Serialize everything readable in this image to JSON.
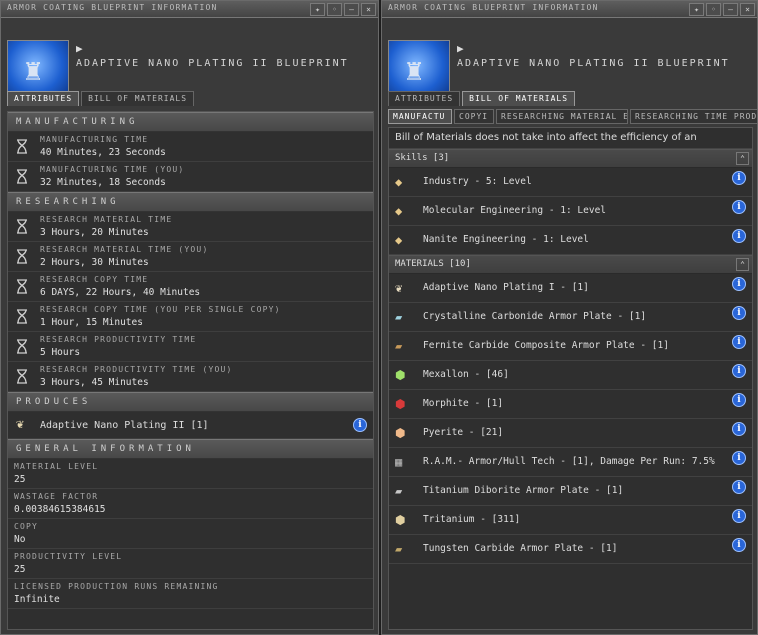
{
  "left_window": {
    "title": "ARMOR COATING BLUEPRINT INFORMATION",
    "blueprint_name": "ADAPTIVE NANO PLATING II BLUEPRINT",
    "tabs": [
      {
        "label": "ATTRIBUTES"
      },
      {
        "label": "BILL OF MATERIALS"
      }
    ],
    "sections": {
      "manufacturing": "MANUFACTURING",
      "researching": "RESEARCHING",
      "produces": "PRODUCES",
      "general": "GENERAL INFORMATION"
    },
    "manufacturing": [
      {
        "label": "MANUFACTURING TIME",
        "value": "40 Minutes, 23 Seconds"
      },
      {
        "label": "MANUFACTURING TIME (YOU)",
        "value": "32 Minutes, 18 Seconds"
      }
    ],
    "researching": [
      {
        "label": "RESEARCH MATERIAL TIME",
        "value": "3 Hours, 20 Minutes"
      },
      {
        "label": "RESEARCH MATERIAL TIME (YOU)",
        "value": "2 Hours, 30 Minutes"
      },
      {
        "label": "RESEARCH COPY TIME",
        "value": "6 DAYS, 22 Hours, 40 Minutes"
      },
      {
        "label": "RESEARCH COPY TIME (YOU PER SINGLE COPY)",
        "value": "1 Hour, 15 Minutes"
      },
      {
        "label": "RESEARCH PRODUCTIVITY TIME",
        "value": "5 Hours"
      },
      {
        "label": "RESEARCH PRODUCTIVITY TIME (YOU)",
        "value": "3 Hours, 45 Minutes"
      }
    ],
    "produces": {
      "text": "Adaptive Nano Plating II [1]"
    },
    "general": [
      {
        "label": "MATERIAL LEVEL",
        "value": "25"
      },
      {
        "label": "WASTAGE FACTOR",
        "value": "0.00384615384615"
      },
      {
        "label": "COPY",
        "value": "No"
      },
      {
        "label": "PRODUCTIVITY LEVEL",
        "value": "25"
      },
      {
        "label": "LICENSED PRODUCTION RUNS REMAINING",
        "value": "Infinite"
      }
    ]
  },
  "right_window": {
    "title": "ARMOR COATING BLUEPRINT INFORMATION",
    "blueprint_name": "ADAPTIVE NANO PLATING II BLUEPRINT",
    "tabs": [
      {
        "label": "ATTRIBUTES"
      },
      {
        "label": "BILL OF MATERIALS"
      }
    ],
    "subtabs": [
      {
        "label": "MANUFACTU"
      },
      {
        "label": "COPYI"
      },
      {
        "label": "RESEARCHING MATERIAL EI"
      },
      {
        "label": "RESEARCHING TIME PROD"
      }
    ],
    "notice": "Bill of Materials does not take into affect the efficiency of an Installation",
    "skills_header": "Skills [3]",
    "skills": [
      {
        "text": "Industry - 5: Level"
      },
      {
        "text": "Molecular Engineering - 1: Level"
      },
      {
        "text": "Nanite Engineering - 1: Level"
      }
    ],
    "materials_header": "MATERIALS [10]",
    "materials": [
      {
        "text": "Adaptive Nano Plating I - [1]",
        "icon": "armor-plating-icon",
        "color": "#e8dcc0"
      },
      {
        "text": "Crystalline Carbonide Armor Plate - [1]",
        "icon": "plate-icon",
        "color": "#9fd3e0"
      },
      {
        "text": "Fernite Carbide Composite Armor Plate - [1]",
        "icon": "plate-icon",
        "color": "#c89a5a"
      },
      {
        "text": "Mexallon - [46]",
        "icon": "mineral-icon",
        "color": "#9fe06a"
      },
      {
        "text": "Morphite - [1]",
        "icon": "mineral-icon",
        "color": "#d83a3a"
      },
      {
        "text": "Pyerite - [21]",
        "icon": "mineral-icon",
        "color": "#f0b98a"
      },
      {
        "text": "R.A.M.- Armor/Hull Tech - [1], Damage Per Run: 7.5%",
        "icon": "ram-tech-icon",
        "color": "#b0b0b0"
      },
      {
        "text": "Titanium Diborite Armor Plate - [1]",
        "icon": "plate-icon",
        "color": "#c8c8c8"
      },
      {
        "text": "Tritanium - [311]",
        "icon": "mineral-icon",
        "color": "#e0cfa0"
      },
      {
        "text": "Tungsten Carbide Armor Plate - [1]",
        "icon": "plate-icon",
        "color": "#c2a86a"
      }
    ]
  }
}
